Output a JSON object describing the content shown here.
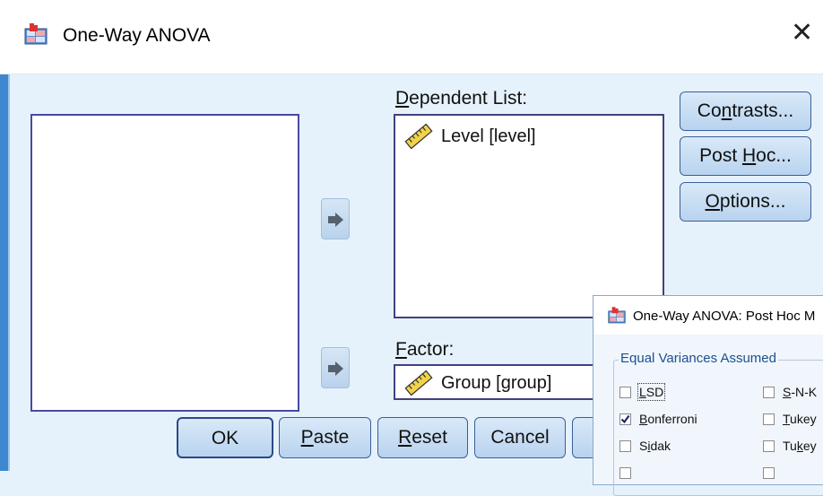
{
  "window": {
    "title": "One-Way ANOVA",
    "close_icon": "close-icon"
  },
  "dependent_list": {
    "label_pre": "D",
    "label_post": "ependent List:",
    "items": [
      {
        "label": "Level [level]",
        "icon": "scale-ruler-icon"
      }
    ]
  },
  "factor": {
    "label_pre": "F",
    "label_post": "actor:",
    "value": "Group [group]",
    "icon": "scale-ruler-icon"
  },
  "right_buttons": {
    "contrasts_pre": "Co",
    "contrasts_ul": "n",
    "contrasts_post": "trasts...",
    "posthoc_pre": "Post ",
    "posthoc_ul": "H",
    "posthoc_post": "oc...",
    "options_ul": "O",
    "options_post": "ptions..."
  },
  "bottom_buttons": {
    "ok": "OK",
    "paste_ul": "P",
    "paste_post": "aste",
    "reset_ul": "R",
    "reset_post": "eset",
    "cancel": "Cancel"
  },
  "posthoc_dialog": {
    "title": "One-Way ANOVA: Post Hoc M",
    "group_title": "Equal Variances Assumed",
    "checkboxes": [
      {
        "label_ul": "L",
        "label_post": "SD",
        "checked": false
      },
      {
        "label_ul": "B",
        "label_post": "onferroni",
        "checked": true
      },
      {
        "label_pre": "S",
        "label_ul": "i",
        "label_post": "dak",
        "checked": false
      },
      {
        "label_ul": "S",
        "label_post": "-N-K",
        "checked": false
      },
      {
        "label_ul": "T",
        "label_post": "ukey",
        "checked": false
      },
      {
        "label_pre": "Tu",
        "label_ul": "k",
        "label_post": "ey",
        "checked": false
      }
    ]
  },
  "colors": {
    "accent": "#3e88d0",
    "button_border": "#3a5f96",
    "list_border": "#4a48a4",
    "group_title": "#1e4f8f"
  }
}
